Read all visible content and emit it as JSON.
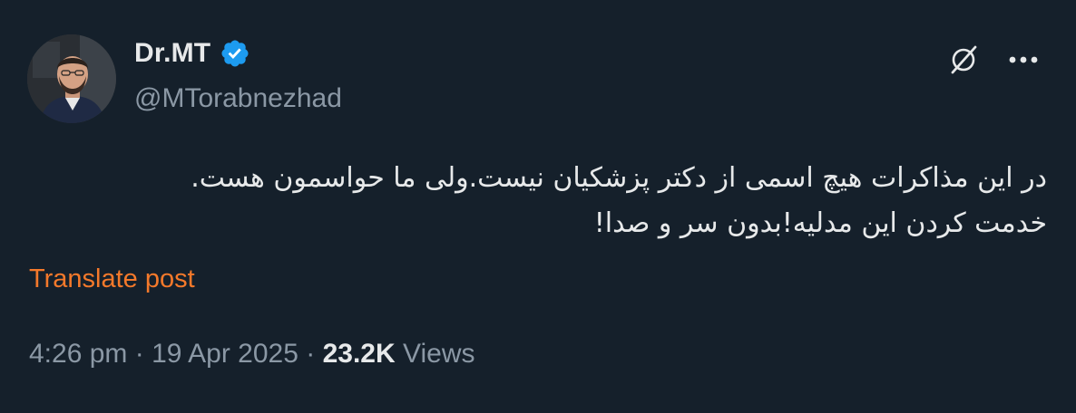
{
  "author": {
    "display_name": "Dr.MT",
    "handle": "@MTorabnezhad",
    "verified": true
  },
  "icons": {
    "verified": "verified-badge-icon",
    "grok": "grok-icon",
    "more": "more-options-icon"
  },
  "post": {
    "lines": [
      "در این مذاکرات هیچ اسمی از دکتر پزشکیان نیست.ولی ما حواسمون هست.",
      "خدمت کردن این مدلیه!بدون سر و صدا!"
    ]
  },
  "translate_label": "Translate post",
  "meta": {
    "time": "4:26 pm",
    "separator": "·",
    "date": "19 Apr 2025",
    "views_count": "23.2K",
    "views_label": "Views"
  },
  "colors": {
    "background": "#15202b",
    "text_primary": "#e7e9ea",
    "text_secondary": "#8b98a5",
    "verified_blue": "#1d9bf0",
    "translate_orange": "#f4792b"
  }
}
